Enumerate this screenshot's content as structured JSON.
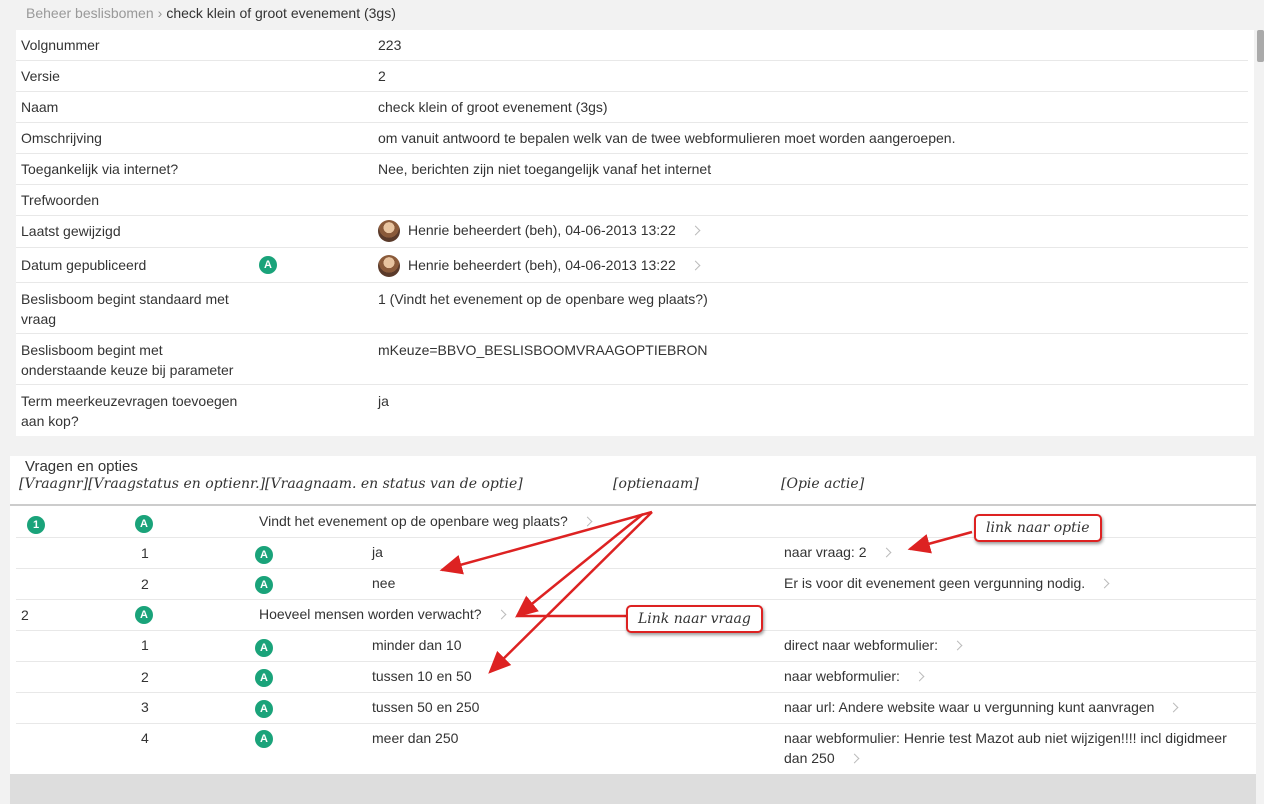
{
  "breadcrumb": {
    "parent": "Beheer beslisbomen",
    "current": "check klein of groot evenement (3gs)"
  },
  "properties": [
    {
      "label": "Volgnummer",
      "value": "223"
    },
    {
      "label": "Versie",
      "value": "2"
    },
    {
      "label": "Naam",
      "value": "check klein of groot evenement (3gs)"
    },
    {
      "label": "Omschrijving",
      "value": "om vanuit antwoord te bepalen welk van de twee webformulieren moet worden aangeroepen."
    },
    {
      "label": "Toegankelijk via internet?",
      "value": "Nee, berichten zijn niet toegangelijk vanaf het internet"
    },
    {
      "label": "Trefwoorden",
      "value": ""
    },
    {
      "label": "Laatst gewijzigd",
      "value": "Henrie beheerdert (beh), 04-06-2013 13:22"
    },
    {
      "label": "Datum gepubliceerd",
      "badge": "A",
      "value": "Henrie beheerdert (beh), 04-06-2013 13:22"
    },
    {
      "label": "Beslisboom begint standaard met vraag",
      "value": "1 (Vindt het evenement op de openbare weg plaats?)"
    },
    {
      "label": "Beslisboom begint met onderstaande keuze bij parameter",
      "value": "mKeuze=BBVO_BESLISBOOMVRAAGOPTIEBRON"
    },
    {
      "label": "Term meerkeuzevragen toevoegen aan kop?",
      "value": "ja"
    }
  ],
  "vragen": {
    "title": "Vragen en opties",
    "header_col1": "[Vraagnr][Vraagstatus en optienr.][Vraagnaam. en status van de optie]",
    "header_col2": "[optienaam]",
    "header_col3": "[Opie actie]",
    "rows": [
      {
        "nr": "1",
        "nr_badge": true,
        "status": "A",
        "text": "Vindt het evenement op de openbare weg plaats?",
        "chev": true
      },
      {
        "optnr": "1",
        "status": "A",
        "name": "ja",
        "action": "naar vraag: 2",
        "chev": true
      },
      {
        "optnr": "2",
        "status": "A",
        "name": "nee",
        "action": "Er is voor dit evenement geen vergunning nodig.",
        "chev": true
      },
      {
        "nr": "2",
        "status": "A",
        "text": "Hoeveel mensen worden verwacht?",
        "chev": true
      },
      {
        "optnr": "1",
        "status": "A",
        "name": "minder dan 10",
        "action": "direct naar webformulier:",
        "chev": true
      },
      {
        "optnr": "2",
        "status": "A",
        "name": "tussen 10 en 50",
        "action": "naar webformulier:",
        "chev": true
      },
      {
        "optnr": "3",
        "status": "A",
        "name": "tussen 50 en 250",
        "action": "naar url: Andere website waar u vergunning kunt aanvragen",
        "chev": true
      },
      {
        "optnr": "4",
        "status": "A",
        "name": "meer dan 250",
        "action": "naar webformulier: Henrie test Mazot aub niet wijzigen!!!! incl digidmeer dan 250",
        "chev": true
      }
    ]
  },
  "annotations": {
    "optie": "link naar optie",
    "vraag": "Link naar vraag"
  },
  "colors": {
    "badge": "#1aa37a",
    "annotation_red": "#dd2222"
  }
}
